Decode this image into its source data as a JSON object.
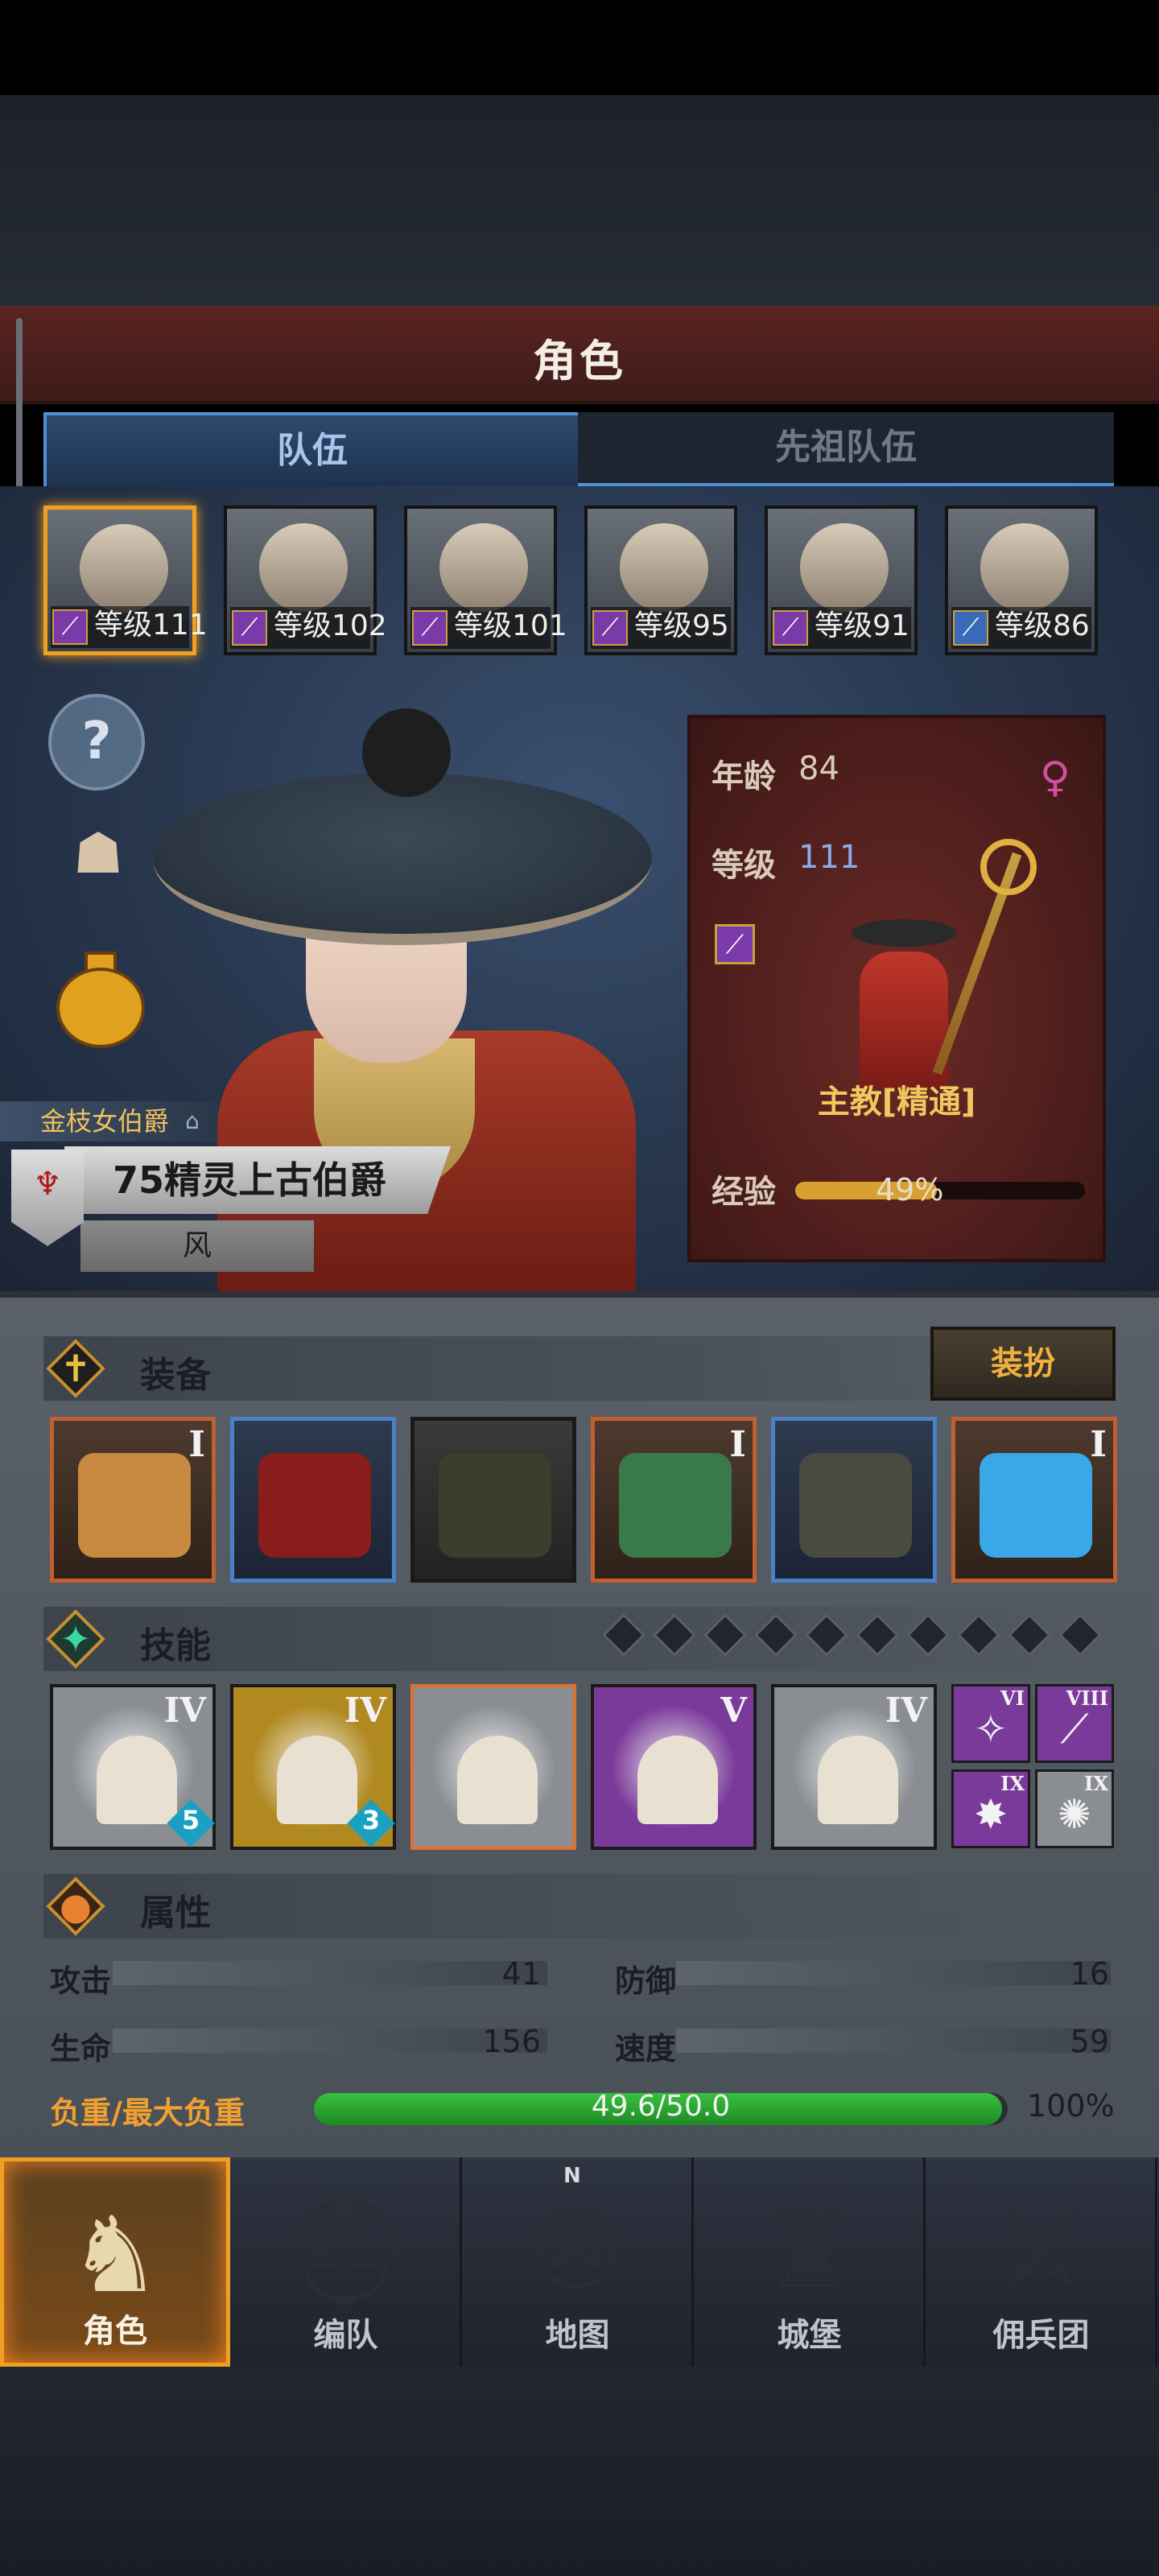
{
  "header": {
    "title": "角色"
  },
  "tabs": [
    {
      "label": "队伍",
      "active": true
    },
    {
      "label": "先祖队伍",
      "active": false
    }
  ],
  "party": [
    {
      "level_text": "等级111",
      "selected": true,
      "class_icon": "wand-icon",
      "class_color": "#7a3aa8"
    },
    {
      "level_text": "等级102",
      "selected": false,
      "class_icon": "wand-icon",
      "class_color": "#7a3aa8"
    },
    {
      "level_text": "等级101",
      "selected": false,
      "class_icon": "wand-icon",
      "class_color": "#7a3aa8"
    },
    {
      "level_text": "等级95",
      "selected": false,
      "class_icon": "wand-icon",
      "class_color": "#7a3aa8"
    },
    {
      "level_text": "等级91",
      "selected": false,
      "class_icon": "wand-icon",
      "class_color": "#7a3aa8"
    },
    {
      "level_text": "等级86",
      "selected": false,
      "class_icon": "sword-icon",
      "class_color": "#3a6ab8"
    }
  ],
  "side_icons": [
    "help-icon",
    "portrait-icon",
    "potion-icon"
  ],
  "character": {
    "subtitle": "金枝女伯爵",
    "title": "75精灵上古伯爵",
    "element": "风",
    "age_label": "年龄",
    "age": "84",
    "level_label": "等级",
    "level": "111",
    "class_name": "主教[精通]",
    "exp_label": "经验",
    "exp_pct": "49%",
    "exp_fraction": 0.49,
    "gender_icon": "female-icon"
  },
  "equipment": {
    "title": "装备",
    "dress_button": "装扮",
    "slots": [
      {
        "name": "staff",
        "rank": "I",
        "style": "orange"
      },
      {
        "name": "tome",
        "rank": "",
        "style": "blue"
      },
      {
        "name": "hood",
        "rank": "",
        "style": "dark"
      },
      {
        "name": "armor",
        "rank": "I",
        "style": "orange"
      },
      {
        "name": "boots",
        "rank": "",
        "style": "blue"
      },
      {
        "name": "amulet",
        "rank": "I",
        "style": "orange"
      }
    ]
  },
  "skills": {
    "title": "技能",
    "gem_count": 10,
    "main": [
      {
        "rank": "IV",
        "count": "5",
        "bg": "#8a8e92"
      },
      {
        "rank": "IV",
        "count": "3",
        "bg": "#b08a20"
      },
      {
        "rank": "",
        "count": "",
        "bg": "#8a8e92"
      },
      {
        "rank": "V",
        "count": "",
        "bg": "#7a3a9a"
      },
      {
        "rank": "IV",
        "count": "",
        "bg": "#8a8e92"
      }
    ],
    "mini": [
      {
        "rank": "VI",
        "bg": "#7a3a9a",
        "glyph": "✧"
      },
      {
        "rank": "VIII",
        "bg": "#7a3a9a",
        "glyph": "⟋"
      },
      {
        "rank": "IX",
        "bg": "#7a3a9a",
        "glyph": "✸"
      },
      {
        "rank": "IX",
        "bg": "#8a8e92",
        "glyph": "✺"
      }
    ]
  },
  "attributes": {
    "title": "属性",
    "attack_label": "攻击",
    "attack": "41",
    "defense_label": "防御",
    "defense": "16",
    "hp_label": "生命",
    "hp": "156",
    "speed_label": "速度",
    "speed": "59",
    "load_label": "负重/最大负重",
    "load_value": "49.6/50.0",
    "load_pct": "100%",
    "load_fraction": 0.992
  },
  "nav": [
    {
      "label": "角色",
      "icon": "knight-icon",
      "active": true
    },
    {
      "label": "编队",
      "icon": "helmet-icon",
      "active": false
    },
    {
      "label": "地图",
      "icon": "compass-icon",
      "active": false
    },
    {
      "label": "城堡",
      "icon": "castle-icon",
      "active": false
    },
    {
      "label": "佣兵团",
      "icon": "mercenary-icon",
      "active": false
    }
  ],
  "compass_n": "N",
  "colors": {
    "accent": "#f0a020",
    "tab_blue": "#4f8fd6",
    "title_red": "#5a2420"
  }
}
